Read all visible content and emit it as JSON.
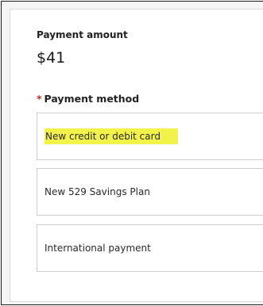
{
  "payment": {
    "amount_label": "Payment amount",
    "amount_value": "$41",
    "method_required_marker": "*",
    "method_label": "Payment method",
    "options": [
      {
        "label": "New credit or debit card",
        "highlighted": true
      },
      {
        "label": "New 529 Savings Plan",
        "highlighted": false
      },
      {
        "label": "International payment",
        "highlighted": false
      }
    ]
  },
  "colors": {
    "required_star": "#c62828",
    "highlight": "#f2f24a",
    "option_border": "#cfcfcf"
  }
}
